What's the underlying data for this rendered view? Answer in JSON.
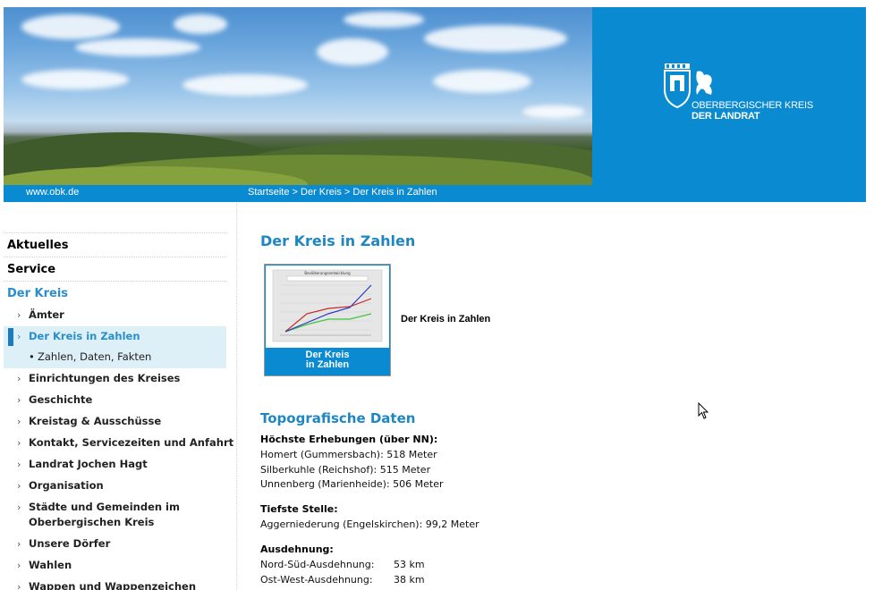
{
  "header": {
    "site_url": "www.obk.de",
    "breadcrumb": [
      "Startseite",
      "Der Kreis",
      "Der Kreis in Zahlen"
    ],
    "breadcrumb_sep": " > ",
    "logo_line1": "OBERBERGISCHER KREIS",
    "logo_line2": "DER LANDRAT",
    "brand_color": "#0a8ad0"
  },
  "sidebar": {
    "top_items": [
      "Aktuelles",
      "Service",
      "Der Kreis"
    ],
    "sub_items": [
      {
        "label": "Ämter"
      },
      {
        "label": "Der Kreis in Zahlen",
        "current": true
      },
      {
        "label": "Einrichtungen des Kreises"
      },
      {
        "label": "Geschichte"
      },
      {
        "label": "Kreistag & Ausschüsse"
      },
      {
        "label": "Kontakt, Servicezeiten und Anfahrt"
      },
      {
        "label": "Landrat Jochen Hagt"
      },
      {
        "label": "Organisation"
      },
      {
        "label": "Städte und Gemeinden im",
        "label2": "Oberbergischen Kreis"
      },
      {
        "label": "Unsere Dörfer"
      },
      {
        "label": "Wahlen"
      },
      {
        "label": "Wappen und Wappenzeichen"
      }
    ],
    "subsub_item": "Zahlen, Daten, Fakten",
    "chevron": "›",
    "bullet": "•",
    "active_color": "#2a8ec8"
  },
  "main": {
    "title": "Der Kreis in Zahlen",
    "teaser_caption_line1": "Der Kreis",
    "teaser_caption_line2": "in Zahlen",
    "teaser_label": "Der Kreis in Zahlen",
    "teaser_chart_title": "Bevölkerungsentwicklung",
    "topo_title": "Topografische Daten",
    "heights_head": "Höchste Erhebungen (über NN):",
    "heights": [
      "Homert (Gummersbach): 518 Meter",
      "Silberkuhle (Reichshof): 515 Meter",
      "Unnenberg (Marienheide): 506 Meter"
    ],
    "lowest_head": "Tiefste Stelle:",
    "lowest": "Aggerniederung (Engelskirchen): 99,2 Meter",
    "extent_head": "Ausdehnung:",
    "extent": [
      {
        "label": "Nord-Süd-Ausdehnung:",
        "value": "53 km"
      },
      {
        "label": "Ost-West-Ausdehnung:",
        "value": "38 km"
      }
    ],
    "title_color": "#1f86c4"
  }
}
